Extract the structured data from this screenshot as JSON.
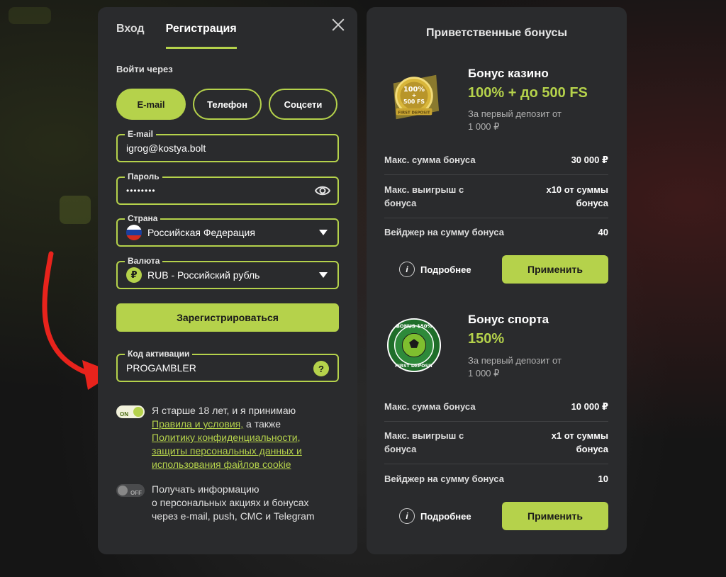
{
  "registration": {
    "tabs": [
      {
        "label": "Вход"
      },
      {
        "label": "Регистрация"
      }
    ],
    "login_via_label": "Войти через",
    "methods": [
      {
        "label": "E-mail"
      },
      {
        "label": "Телефон"
      },
      {
        "label": "Соцсети"
      }
    ],
    "email": {
      "label": "E-mail",
      "value": "igrog@kostya.bolt"
    },
    "password": {
      "label": "Пароль",
      "value": "••••••••"
    },
    "country": {
      "label": "Страна",
      "value": "Российская Федерация"
    },
    "currency": {
      "label": "Валюта",
      "value": "RUB - Российский рубль",
      "symbol": "₽"
    },
    "register_button": "Зарегистрироваться",
    "activation_code": {
      "label": "Код активации",
      "value": "PROGAMBLER",
      "help": "?"
    },
    "terms": {
      "toggle": "ON",
      "text1": "Я старше 18 лет, и я принимаю",
      "link1": "Правила и условия,",
      "text2": " а также",
      "link2_line1": "Политику конфиденциальности,",
      "link2_line2": "защиты персональных данных и",
      "link2_line3": "использования файлов cookie"
    },
    "newsletter": {
      "toggle": "OFF",
      "line1": "Получать информацию",
      "line2": "о персональных акциях и бонусах",
      "line3": "через e-mail, push, СМС и Telegram"
    }
  },
  "bonuses": {
    "title": "Приветственные бонусы",
    "casino": {
      "name": "Бонус казино",
      "value": "100% + до 500 FS",
      "desc_line1": "За первый депозит от",
      "desc_line2": "1 000 ₽",
      "badge_top": "100%",
      "badge_plus": "+",
      "badge_fs": "500 FS",
      "badge_ribbon": "FIRST DEPOSIT",
      "rows": [
        {
          "label": "Макс. сумма бонуса",
          "label2": "",
          "value": "30 000 ₽",
          "value2": ""
        },
        {
          "label": "Макс. выигрыш с",
          "label2": "бонуса",
          "value": "x10 от суммы",
          "value2": "бонуса"
        },
        {
          "label": "Вейджер на сумму бонуса",
          "label2": "",
          "value": "40",
          "value2": ""
        }
      ],
      "more": "Подробнее",
      "apply": "Применить"
    },
    "sport": {
      "name": "Бонус спорта",
      "value": "150%",
      "desc_line1": "За первый депозит от",
      "desc_line2": "1 000 ₽",
      "badge_top": "BONUS 150%",
      "badge_bottom": "FIRST DEPOSIT",
      "rows": [
        {
          "label": "Макс. сумма бонуса",
          "label2": "",
          "value": "10 000 ₽",
          "value2": ""
        },
        {
          "label": "Макс. выигрыш с",
          "label2": "бонуса",
          "value": "x1 от суммы",
          "value2": "бонуса"
        },
        {
          "label": "Вейджер на сумму бонуса",
          "label2": "",
          "value": "10",
          "value2": ""
        }
      ],
      "more": "Подробнее",
      "apply": "Применить"
    }
  },
  "colors": {
    "accent": "#b5d24b",
    "panel": "#2a2b2d",
    "arrow": "#e8231c"
  }
}
